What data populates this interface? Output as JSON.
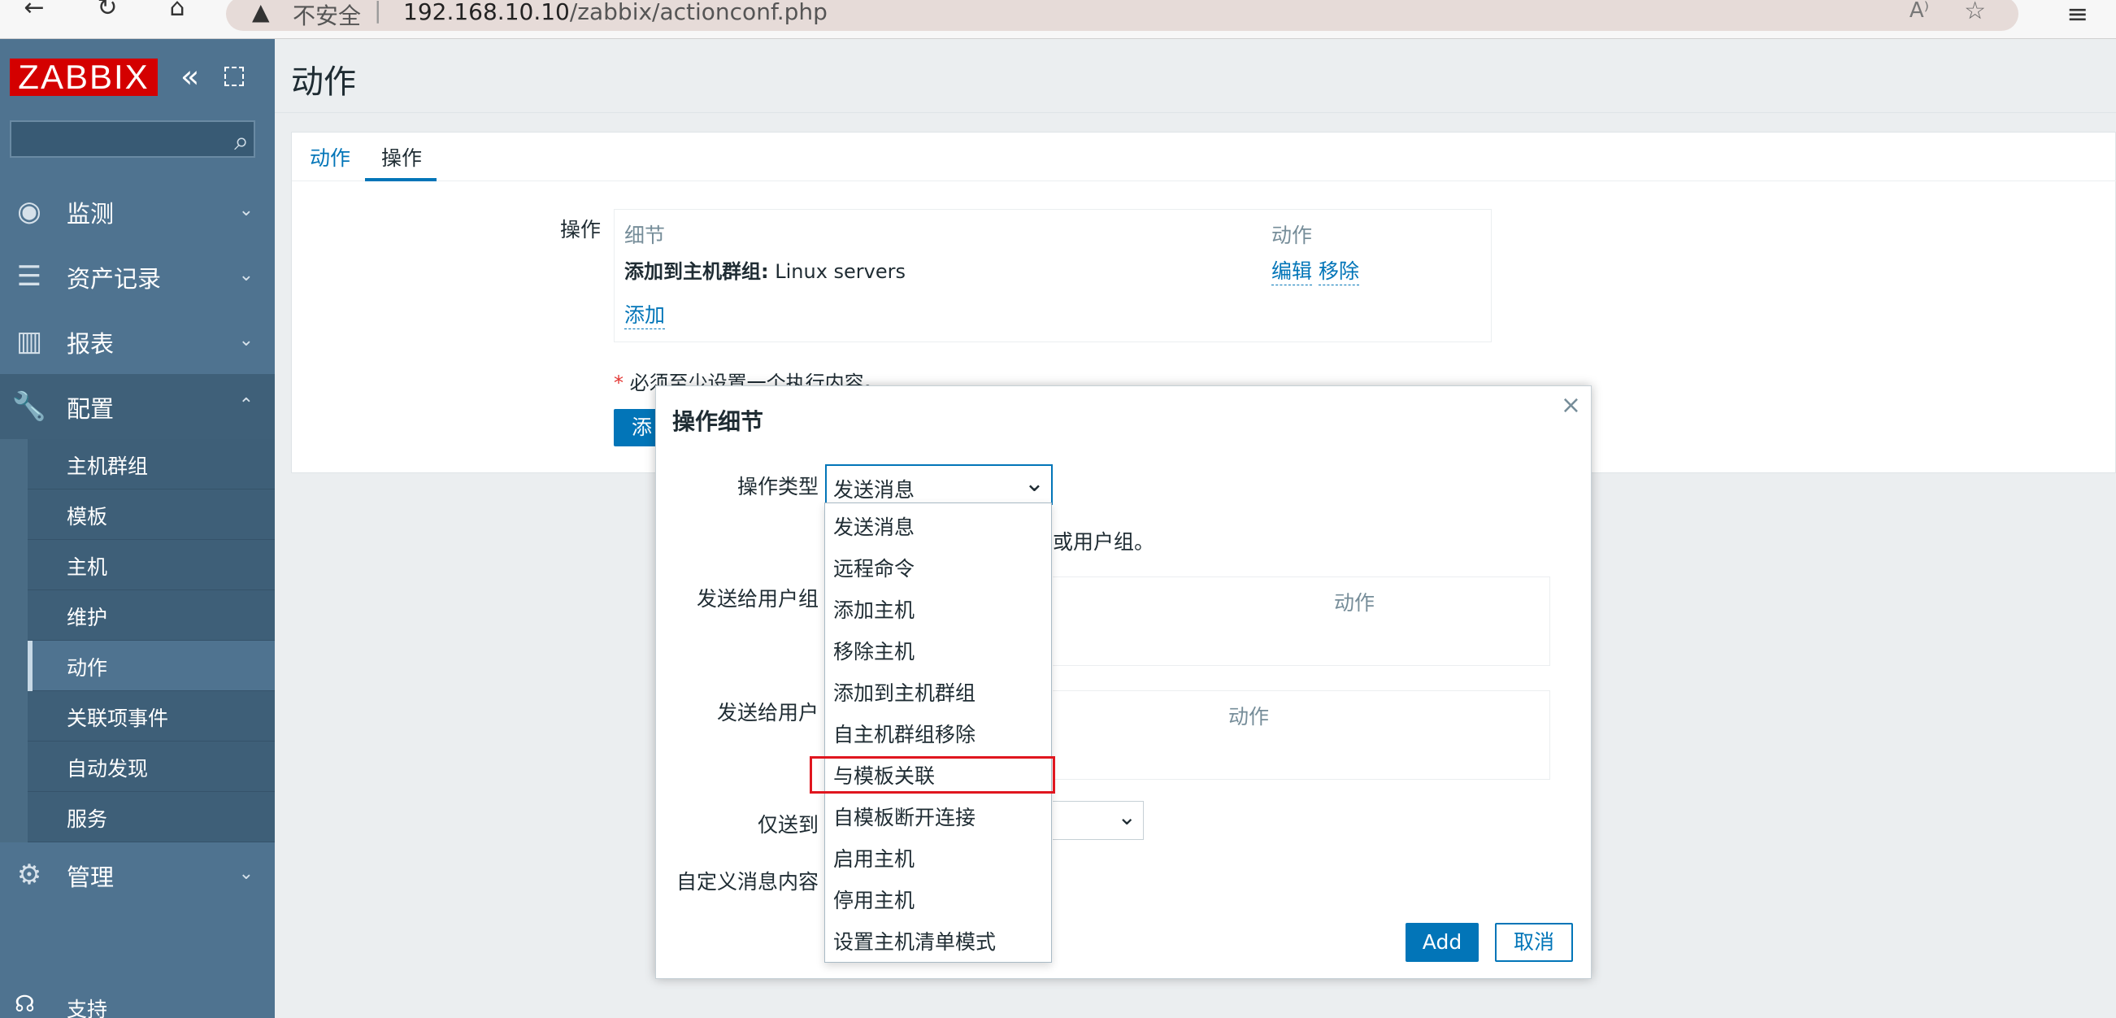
{
  "browser": {
    "warn_icon": "▲",
    "insecure": "不安全",
    "sep": "|",
    "url_host": "192.168.10.10",
    "url_path": "/zabbix/actionconf.php",
    "read_icon": "A⁾",
    "fav_icon": "☆",
    "menu_icon": "≡"
  },
  "sidebar": {
    "logo": "ZABBIX",
    "menu": [
      {
        "label": "监测",
        "icon": "eye-icon"
      },
      {
        "label": "资产记录",
        "icon": "list-icon"
      },
      {
        "label": "报表",
        "icon": "bar-chart-icon"
      },
      {
        "label": "配置",
        "icon": "wrench-icon"
      },
      {
        "label": "管理",
        "icon": "gear-icon"
      }
    ],
    "submenu": [
      "主机群组",
      "模板",
      "主机",
      "维护",
      "动作",
      "关联项事件",
      "自动发现",
      "服务"
    ],
    "support": "支持"
  },
  "main": {
    "title": "动作",
    "tabs": [
      "动作",
      "操作"
    ],
    "ops_label": "操作",
    "table": {
      "col_detail": "细节",
      "col_action": "动作",
      "row_bold": "添加到主机群组:",
      "row_value": " Linux servers",
      "edit": "编辑",
      "remove": "移除",
      "add": "添加"
    },
    "required_star": "*",
    "required_note": " 必须至少设置一个执行内容。",
    "add_button": "添加"
  },
  "modal": {
    "title": "操作细节",
    "close": "×",
    "op_type_label": "操作类型",
    "op_type_value": "发送消息",
    "hint_tail": "或用户组。",
    "send_to_groups_label": "发送给用户组",
    "send_to_groups_col": "动作",
    "send_to_users_label": "发送给用户",
    "send_to_users_col": "动作",
    "only_send_label": "仅送到",
    "custom_message_label": "自定义消息内容",
    "add_button": "Add",
    "cancel_button": "取消"
  },
  "dropdown": {
    "options": [
      "发送消息",
      "远程命令",
      "添加主机",
      "移除主机",
      "添加到主机群组",
      "自主机群组移除",
      "与模板关联",
      "自模板断开连接",
      "启用主机",
      "停用主机",
      "设置主机清单模式"
    ],
    "highlighted": "与模板关联"
  }
}
